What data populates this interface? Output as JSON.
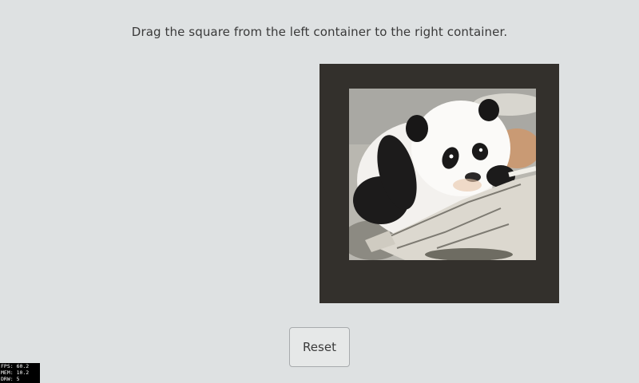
{
  "instruction": "Drag the square from the left container to the right container.",
  "reset_label": "Reset",
  "draggable": {
    "content": "panda-cub-photo"
  },
  "stats": {
    "fps": "FPS: 60.2",
    "mem": "MEM: 10.2",
    "drw": "DRW: 5"
  },
  "colors": {
    "background": "#dee1e2",
    "right_container": "#33302c",
    "button_bg": "#e6e8e8",
    "button_border": "#a8abad"
  }
}
